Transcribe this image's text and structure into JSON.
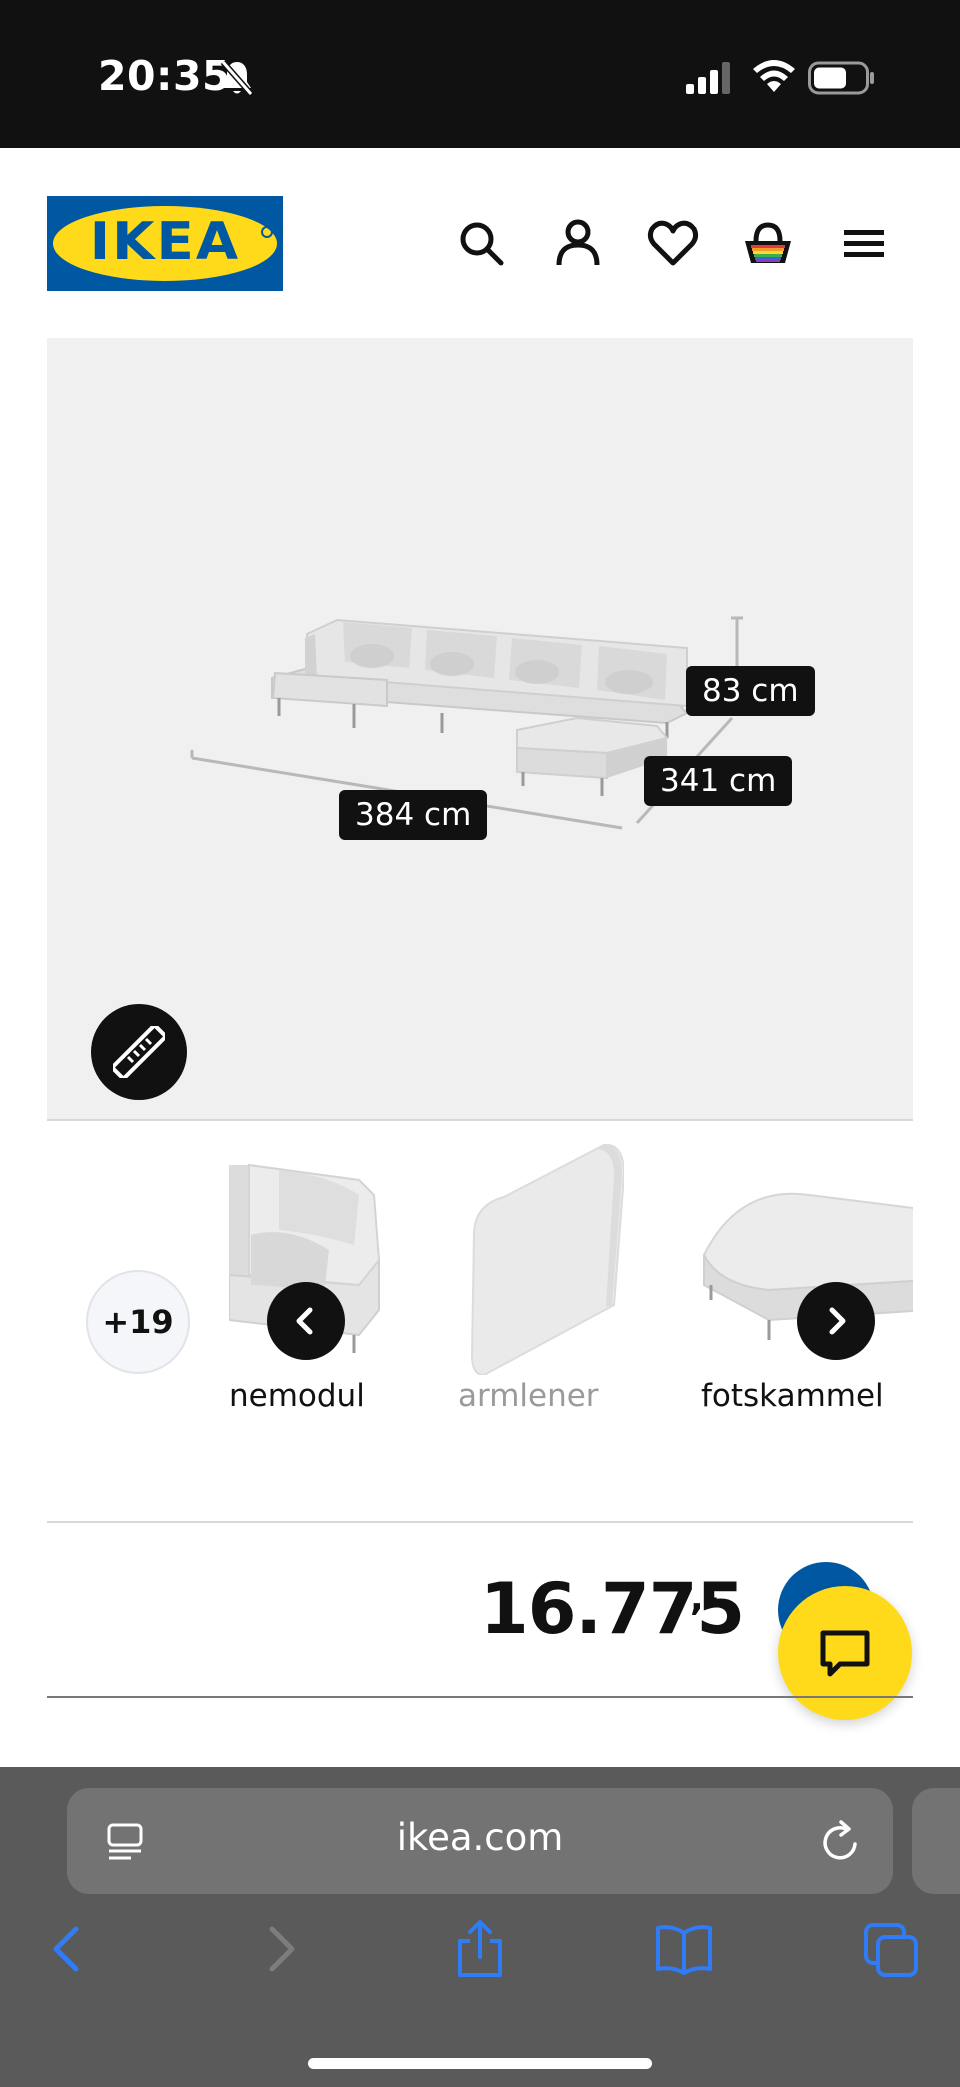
{
  "status_bar": {
    "time": "20:35",
    "icons": [
      "bell-slash-icon",
      "cellular-signal-icon",
      "wifi-icon",
      "battery-icon"
    ]
  },
  "header": {
    "logo_text": "IKEA",
    "icons": [
      "search-icon",
      "account-icon",
      "wishlist-heart-icon",
      "shopping-basket-icon",
      "menu-icon"
    ],
    "colors": {
      "brand_blue": "#0058a3",
      "brand_yellow": "#ffda1a"
    }
  },
  "product_image": {
    "dimensions": {
      "height": "83 cm",
      "depth": "341 cm",
      "width": "384 cm"
    },
    "measure_icon": "ruler-icon"
  },
  "carousel": {
    "more_count": "+19",
    "items": [
      {
        "label": "nemodul",
        "icon": "corner-module-icon"
      },
      {
        "label": "armlener",
        "icon": "armrest-icon"
      },
      {
        "label": "fotskammel",
        "icon": "footstool-icon"
      }
    ]
  },
  "price": {
    "amount": "16.775",
    "suffix": ",-"
  },
  "browser": {
    "url": "ikea.com",
    "toolbar": [
      "back-icon",
      "forward-icon",
      "share-icon",
      "bookmarks-icon",
      "tabs-icon"
    ]
  }
}
